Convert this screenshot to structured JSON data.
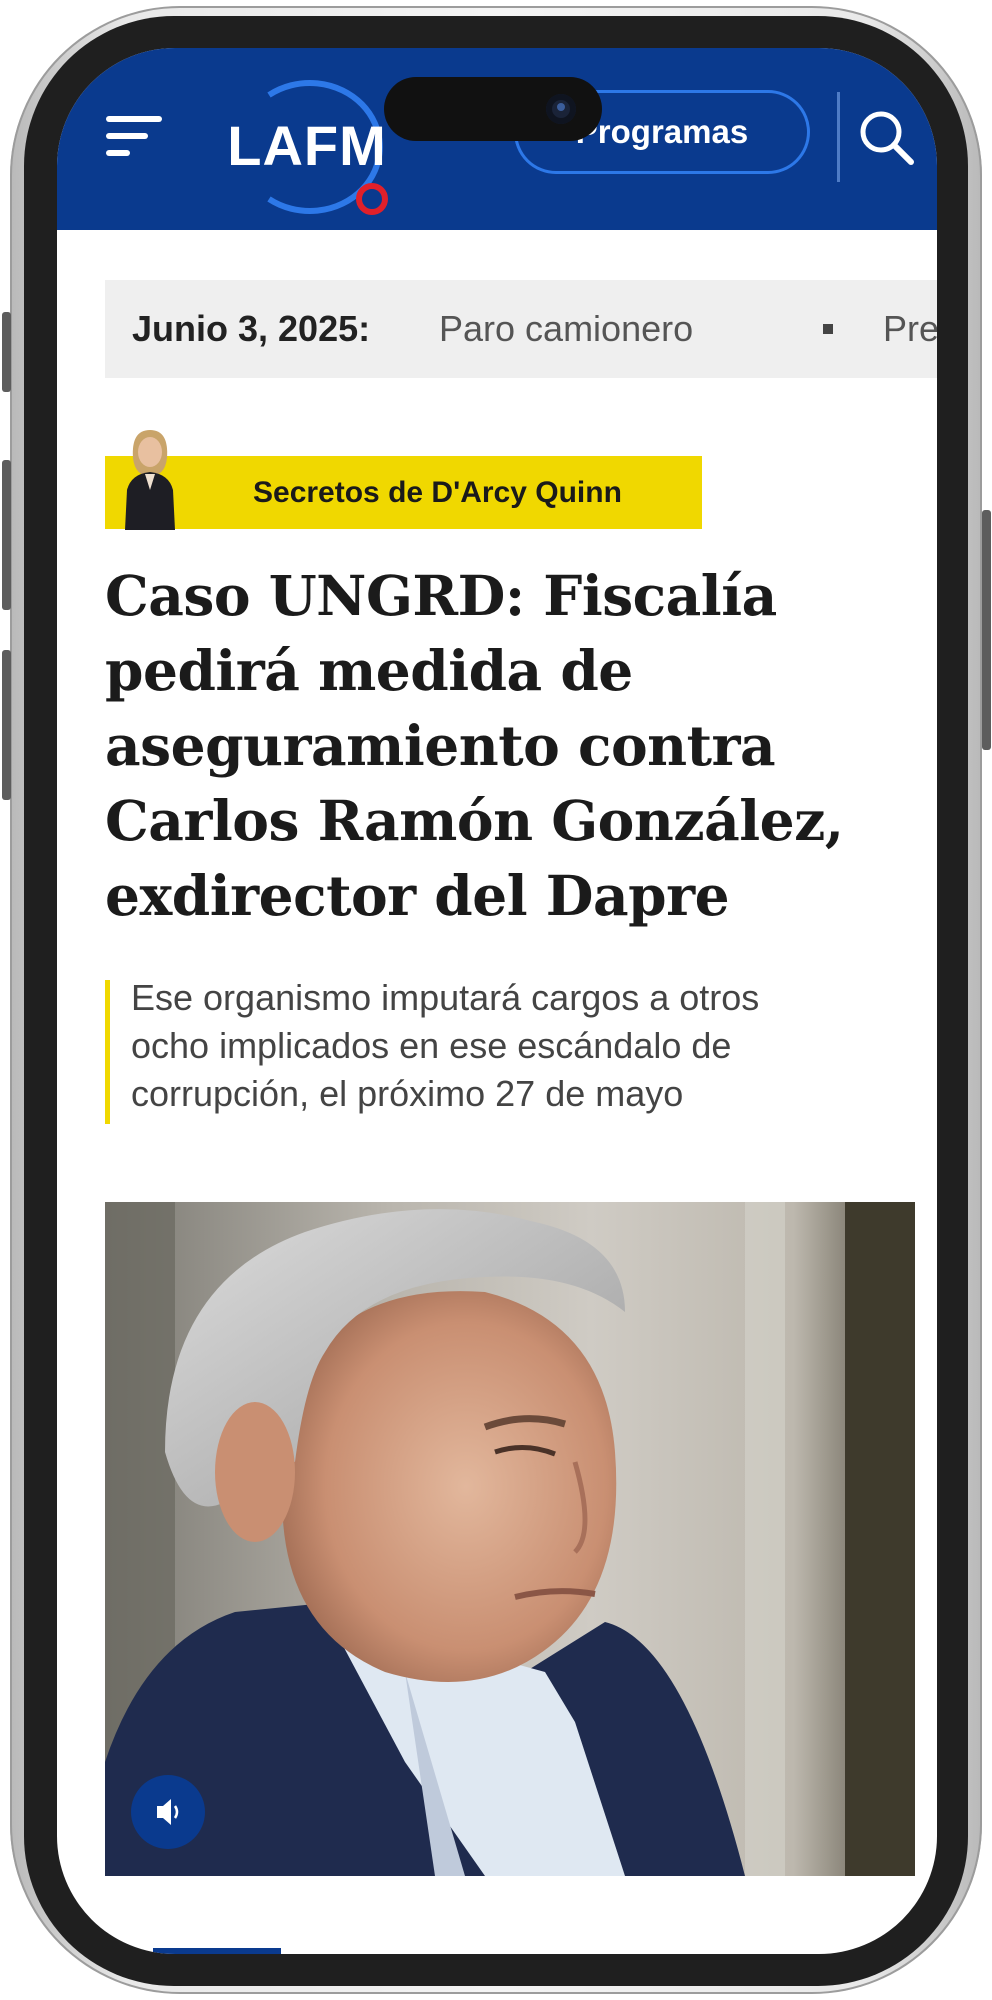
{
  "header": {
    "logo_text": "LAFM",
    "programs_label": "Programas",
    "brand_color": "#0a3a8e",
    "menu_icon": "menu-icon",
    "search_icon": "search-icon"
  },
  "ticker": {
    "date": "Junio 3, 2025:",
    "items": [
      "Paro camionero",
      "Pres"
    ]
  },
  "author_badge": {
    "label": "Secretos de D'Arcy Quinn",
    "color": "#f0d800"
  },
  "article": {
    "headline_lines": [
      "Caso UNGRD: Fiscalía",
      "pedirá medida de",
      "aseguramiento contra",
      "Carlos Ramón González,",
      "exdirector del Dapre"
    ],
    "summary_lines": [
      "Ese organismo imputará cargos a otros",
      "ocho implicados en ese escándalo de",
      "corrupción, el próximo 27 de mayo"
    ],
    "audio_icon": "speaker-icon"
  }
}
